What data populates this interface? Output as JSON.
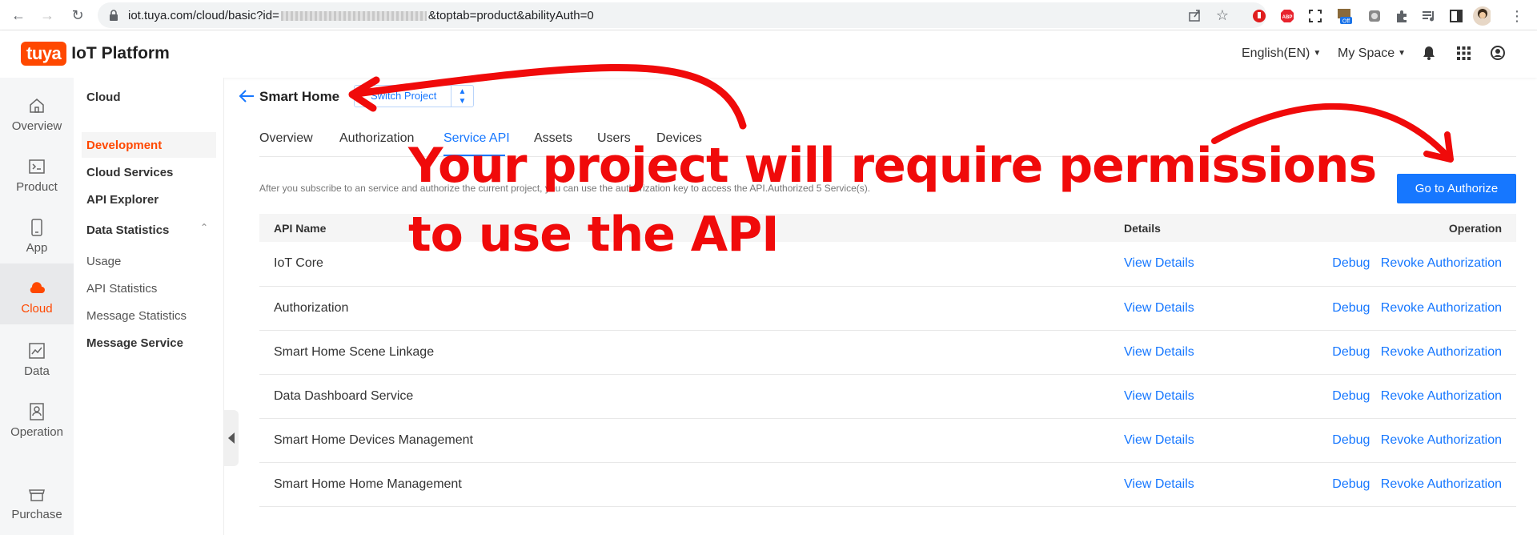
{
  "browser": {
    "url_prefix": "iot.tuya.com/cloud/basic?id=",
    "url_suffix": "&toptab=product&abilityAuth=0",
    "ext_off_badge": "Off"
  },
  "header": {
    "logo_brand": "tuya",
    "logo_title": "IoT Platform",
    "language": "English(EN)",
    "space": "My Space"
  },
  "rail": [
    {
      "label": "Overview",
      "icon": "home-icon"
    },
    {
      "label": "Product",
      "icon": "terminal-icon"
    },
    {
      "label": "App",
      "icon": "phone-icon"
    },
    {
      "label": "Cloud",
      "icon": "cloud-icon"
    },
    {
      "label": "Data",
      "icon": "chart-icon"
    },
    {
      "label": "Operation",
      "icon": "person-card-icon"
    },
    {
      "label": "Purchase",
      "icon": "shop-icon"
    }
  ],
  "submenu": {
    "title": "Cloud",
    "development": "Development",
    "cloud_services": "Cloud Services",
    "api_explorer": "API Explorer",
    "data_statistics": "Data Statistics",
    "usage": "Usage",
    "api_statistics": "API Statistics",
    "message_statistics": "Message Statistics",
    "message_service": "Message Service"
  },
  "project": {
    "title": "Smart Home",
    "switch_label": "Switch Project"
  },
  "tabs": [
    "Overview",
    "Authorization",
    "Service API",
    "Assets",
    "Users",
    "Devices"
  ],
  "description": "After you subscribe to an service and authorize the current project, you can use the authorization key to access the API.Authorized 5 Service(s).",
  "authorize_button": "Go to Authorize",
  "table": {
    "headers": {
      "name": "API Name",
      "details": "Details",
      "operation": "Operation"
    },
    "view_details": "View Details",
    "debug": "Debug",
    "revoke": "Revoke Authorization",
    "rows": [
      "IoT Core",
      "Authorization",
      "Smart Home Scene Linkage",
      "Data Dashboard Service",
      "Smart Home Devices Management",
      "Smart Home Home Management"
    ]
  },
  "annotation": {
    "line1": "Your project will require permissions",
    "line2": "to use the API",
    "color": "#f00a0a"
  },
  "colors": {
    "accent": "#1677ff",
    "brand": "#ff4800"
  }
}
